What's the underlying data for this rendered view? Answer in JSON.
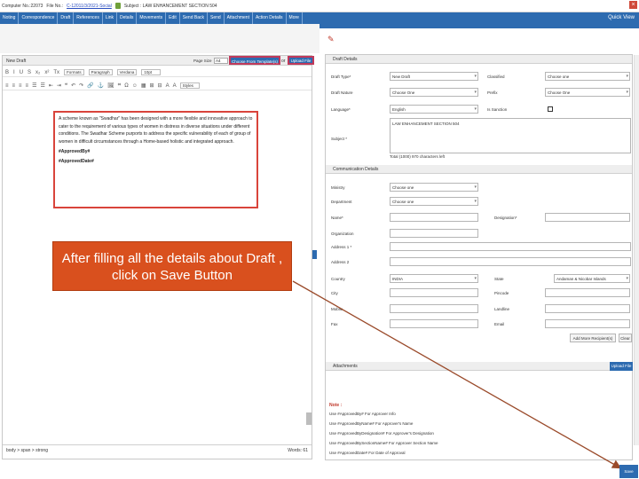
{
  "topbar": {
    "computer_no": "Computer No.:22073",
    "file_no_label": "File No.:",
    "file_no": "C-12011/3/2021-Social",
    "subject": "Subject : LAW ENHANCEMENT SECTION 504",
    "close_symbol": "×"
  },
  "nav": {
    "tabs": [
      "Noting",
      "Correspondence",
      "Draft",
      "References",
      "Link",
      "Details",
      "Movements",
      "Edit",
      "Send Back",
      "Send",
      "Attachment",
      "Action Details",
      "More"
    ],
    "quick_view": "Quick View"
  },
  "editor": {
    "title": "New Draft",
    "page_size_label": "Page Size",
    "page_size_value": "A4",
    "choose_template_label": "Choose From Template(s)",
    "or_label": "or",
    "upload_file_label": "Upload File",
    "toolbar_row1_icons": [
      "B",
      "I",
      "U",
      "S",
      "x₂",
      "x²",
      "Tx"
    ],
    "toolbar_row1_selects": [
      "Formats",
      "Paragraph",
      "Verdana",
      "10pt"
    ],
    "toolbar_row2_icons": [
      "≡",
      "≡",
      "≡",
      "≡",
      "☰",
      "☰",
      "⇤",
      "⇥",
      "❝",
      "↶",
      "↷",
      "🔗",
      "⚓",
      "🖼",
      "⌗",
      "Ω",
      "☺",
      "▦",
      "⊞",
      "⊟",
      "A",
      "A"
    ],
    "toolbar_row2_select": "Styles",
    "body_paragraph": "A scheme known as \"Swadhar\" has been designed with a more flexible and innovative approach to cater to the requirement of various types of women in distress in diverse situations under different conditions. The Swadhar Scheme purports to address the specific vulnerability of each of group of women in difficult circumstances through a Home-based holistic and integrated approach.",
    "approved_by": "#ApprovedBy#",
    "approved_date": "#ApprovedDate#",
    "status_path": "body > span > strong",
    "word_count": "Words: 61"
  },
  "draft_details": {
    "header": "Draft Details",
    "draft_type_label": "Draft Type*",
    "draft_type_value": "New Draft",
    "classified_label": "Classified",
    "classified_value": "Choose one",
    "draft_nature_label": "Draft Nature",
    "draft_nature_value": "Choose One",
    "prefix_label": "Prefix",
    "prefix_value": "Choose One",
    "language_label": "Language*",
    "language_value": "English",
    "is_sanction_label": "Is Sanction",
    "subject_label": "Subject *",
    "subject_value": "LAW ENHANCEMENT SECTION 504",
    "char_count": "Total (1000)  970  characters left"
  },
  "communication": {
    "header": "Communication Details",
    "ministry_label": "Ministry",
    "ministry_value": "Choose one",
    "department_label": "Department",
    "department_value": "Choose one",
    "name_label": "Name*",
    "designation_label": "Designation*",
    "organization_label": "Organization",
    "address1_label": "Address 1 *",
    "address2_label": "Address 2",
    "country_label": "Country",
    "country_value": "INDIA",
    "state_label": "State",
    "state_value": "Andaman & Nicobar Islands",
    "city_label": "City",
    "pincode_label": "Pincode",
    "mobile_label": "Mobile",
    "landline_label": "Landline",
    "fax_label": "Fax",
    "email_label": "Email",
    "add_more_label": "Add More Recipient(s)",
    "clear_label": "Clear"
  },
  "attachments": {
    "header": "Attachments",
    "upload_label": "Upload File"
  },
  "note": {
    "title": "Note :",
    "lines": [
      "Use #ApprovedBy# For Approver Info",
      "Use #ApprovedByName# For Approver's Name",
      "Use #ApprovedByDesignation# For Approver's Designation",
      "Use #ApprovedBySectionName# For Approver Section Name",
      "Use #ApprovedDate# For Date of Approval"
    ]
  },
  "callout": {
    "text": "After filling all the details about Draft , click on Save Button"
  },
  "save_label": "Save",
  "colors": {
    "nav_blue": "#2d6bb0",
    "callout_orange": "#d9501e",
    "highlight_red": "#c0395a",
    "arrow_brown": "#9a4a2a"
  }
}
